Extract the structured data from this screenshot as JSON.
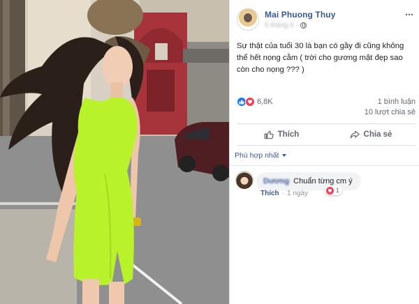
{
  "post": {
    "author": "Mai Phuong Thuy",
    "meta_blurred": "5 tháng 6",
    "more_label": "···",
    "text": "Sự thật của tuổi 30 là bạn có gầy đi cũng không thể hết nọng cằm ( trời cho gương mặt đẹp sao còn cho nọng ??? )",
    "reaction_count": "6,8K",
    "comments_count": "1 bình luận",
    "shares_count": "10 lượt chia sẻ",
    "like_label": "Thích",
    "share_label": "Chia sẻ"
  },
  "comments_section": {
    "sort_label": "Phù hợp nhất",
    "items": [
      {
        "author_blurred": "Dương",
        "text": "Chuẩn từng cm ý",
        "reaction_count": "1",
        "like_label": "Thích",
        "separator": "·",
        "time": "1 ngày"
      }
    ]
  },
  "icons": {
    "reaction_like": "like-reaction-icon",
    "reaction_love": "love-reaction-icon",
    "like_action": "thumbs-up-icon",
    "share_action": "share-arrow-icon",
    "privacy": "globe-icon"
  },
  "colors": {
    "brand_link": "#385898",
    "like_blue": "#1877f2",
    "love_red": "#f33e58",
    "dress_green": "#b8f22a"
  }
}
